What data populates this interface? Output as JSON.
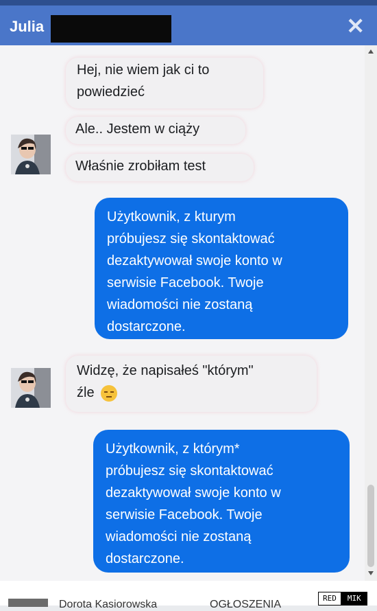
{
  "header": {
    "name": "Julia",
    "close_label": "✕",
    "color": "#4a76c9"
  },
  "messages": {
    "in1_line1": "Hej, nie wiem jak ci to",
    "in1_line2": "powiedzieć",
    "in2": "Ale.. Jestem w ciąży",
    "in3": "Właśnie zrobiłam test",
    "out1_lines": [
      "Użytkownik, z kturym",
      "próbujesz się skontaktować",
      "dezaktywował swoje konto w",
      "serwisie Facebook. Twoje",
      "wiadomości nie zostaną",
      "dostarczone."
    ],
    "in4_line1": "Widzę, że napisałeś \"którym\"",
    "in4_line2": "źle",
    "out2_lines": [
      "Użytkownik, z którym*",
      "próbujesz się skontaktować",
      "dezaktywował swoje konto w",
      "serwisie Facebook. Twoje",
      "wiadomości nie zostaną",
      "dostarczone."
    ]
  },
  "footer": {
    "name": "Dorota Kasiorowska",
    "section": "OGŁOSZENIA"
  },
  "watermark": {
    "left": "RED",
    "right": "MIK"
  },
  "icons": {
    "close": "close-icon",
    "emoji": "unamused-face-icon",
    "avatar": "avatar"
  },
  "colors": {
    "outgoing_bubble": "#0e6fe6",
    "incoming_bubble": "#f1f0f2"
  }
}
